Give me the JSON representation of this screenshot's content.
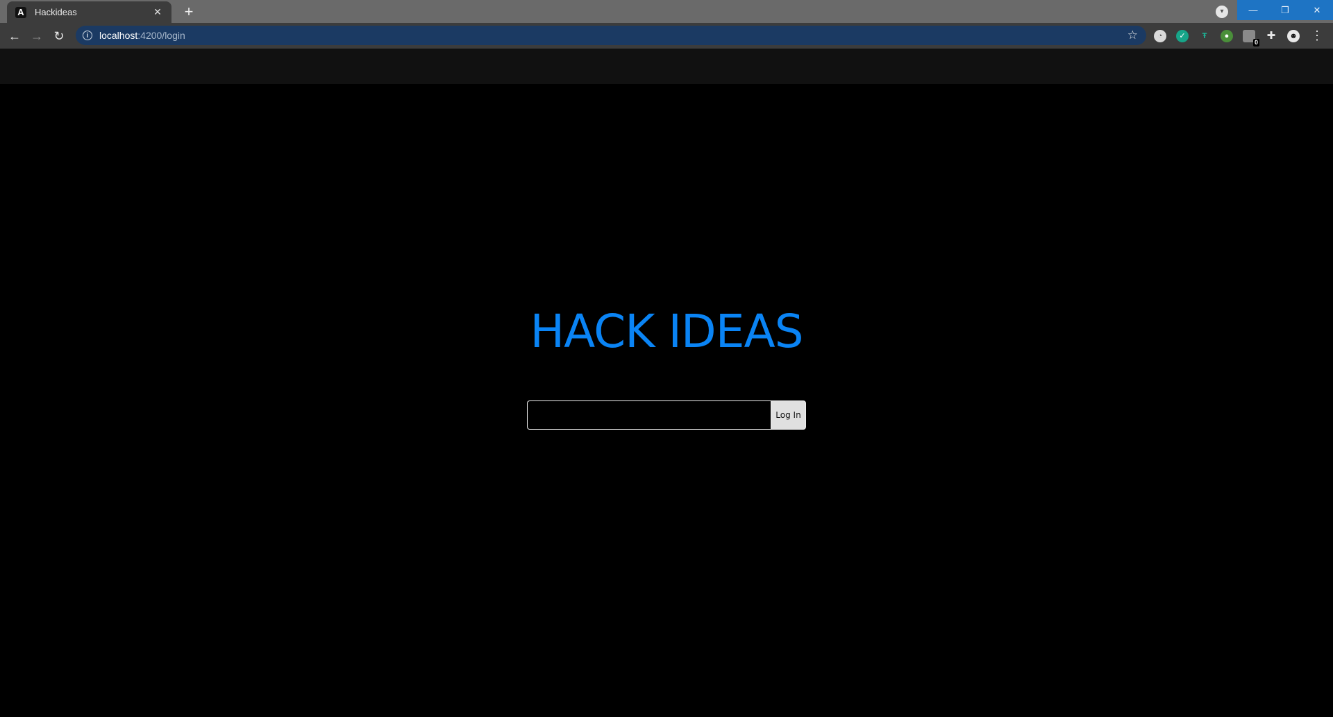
{
  "browser": {
    "tab": {
      "favicon_letter": "A",
      "title": "Hackideas",
      "close_glyph": "✕"
    },
    "new_tab_glyph": "+",
    "address": {
      "host": "localhost",
      "path": ":4200/login"
    },
    "extension_badge": "0",
    "window_controls": {
      "minimize": "—",
      "restore": "❐",
      "close": "✕"
    }
  },
  "page": {
    "title": "HACK IDEAS",
    "login": {
      "input_value": "",
      "input_placeholder": "",
      "button_label": "Log In"
    }
  },
  "colors": {
    "accent": "#0a84f5",
    "omnibox": "#1b3a63",
    "window_controls": "#1e74c4"
  },
  "icons": {
    "back": "back-arrow-icon",
    "forward": "forward-arrow-icon",
    "reload": "reload-icon",
    "info": "info-icon",
    "bookmark": "star-icon",
    "extensions": "puzzle-icon",
    "menu": "kebab-menu-icon"
  }
}
